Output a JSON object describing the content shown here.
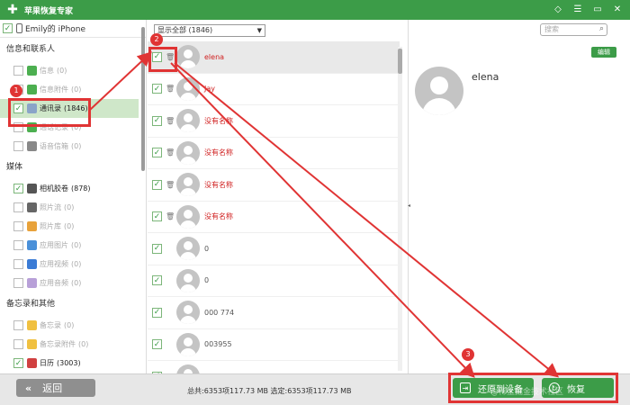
{
  "app": {
    "title": "苹果恢复专家"
  },
  "window_controls": [
    "diamond-icon",
    "settings-icon",
    "minimize-icon",
    "close-icon"
  ],
  "sidebar": {
    "device": "Emily的 iPhone",
    "groups": [
      {
        "title": "信息和联系人",
        "items": [
          {
            "label": "信息",
            "count": "(0)",
            "checked": false,
            "icon": "message-icon",
            "color": "#4caf50"
          },
          {
            "label": "信息附件",
            "count": "(0)",
            "checked": false,
            "icon": "attachment-icon",
            "color": "#4caf50"
          },
          {
            "label": "通讯录",
            "count": "(1846)",
            "checked": true,
            "icon": "contacts-icon",
            "color": "#8aa4c8"
          },
          {
            "label": "通话记录",
            "count": "(0)",
            "checked": false,
            "icon": "phone-icon",
            "color": "#4caf50"
          },
          {
            "label": "语音信箱",
            "count": "(0)",
            "checked": false,
            "icon": "voicemail-icon",
            "color": "#888"
          }
        ]
      },
      {
        "title": "媒体",
        "items": [
          {
            "label": "相机胶卷",
            "count": "(878)",
            "checked": true,
            "icon": "camera-icon",
            "color": "#555"
          },
          {
            "label": "照片流",
            "count": "(0)",
            "checked": false,
            "icon": "photostream-icon",
            "color": "#666"
          },
          {
            "label": "照片库",
            "count": "(0)",
            "checked": false,
            "icon": "photos-icon",
            "color": "#e8a23a"
          },
          {
            "label": "应用图片",
            "count": "(0)",
            "checked": false,
            "icon": "app-photo-icon",
            "color": "#4a90d9"
          },
          {
            "label": "应用视频",
            "count": "(0)",
            "checked": false,
            "icon": "app-video-icon",
            "color": "#3a7bd5"
          },
          {
            "label": "应用音频",
            "count": "(0)",
            "checked": false,
            "icon": "music-icon",
            "color": "#b8a0d8"
          }
        ]
      },
      {
        "title": "备忘录和其他",
        "items": [
          {
            "label": "备忘录",
            "count": "(0)",
            "checked": false,
            "icon": "notes-icon",
            "color": "#f0c040"
          },
          {
            "label": "备忘录附件",
            "count": "(0)",
            "checked": false,
            "icon": "notes-attach-icon",
            "color": "#f0c040"
          },
          {
            "label": "日历",
            "count": "(3003)",
            "checked": true,
            "icon": "calendar-icon",
            "color": "#d04040"
          }
        ]
      }
    ]
  },
  "list": {
    "filter": "显示全部 (1846)",
    "rows": [
      {
        "name": "elena",
        "red": true,
        "checked": true,
        "selected": true
      },
      {
        "name": "Jay",
        "red": true,
        "checked": true,
        "selected": false
      },
      {
        "name": "没有名称",
        "red": true,
        "checked": true,
        "selected": false
      },
      {
        "name": "没有名称",
        "red": true,
        "checked": true,
        "selected": false
      },
      {
        "name": "没有名称",
        "red": true,
        "checked": true,
        "selected": false
      },
      {
        "name": "没有名称",
        "red": true,
        "checked": true,
        "selected": false
      },
      {
        "name": "0",
        "red": false,
        "checked": true,
        "selected": false
      },
      {
        "name": "0",
        "red": false,
        "checked": true,
        "selected": false
      },
      {
        "name": "000 774",
        "red": false,
        "checked": true,
        "selected": false
      },
      {
        "name": "003955",
        "red": false,
        "checked": true,
        "selected": false
      },
      {
        "name": "",
        "red": false,
        "checked": true,
        "selected": false
      }
    ]
  },
  "detail": {
    "search_placeholder": "搜索",
    "edit": "编辑",
    "name": "elena"
  },
  "footer": {
    "back": "返回",
    "totals": "总共:6353项117.73 MB 选定:6353项117.73 MB",
    "restore_device": "还原到设备",
    "recover": "恢复",
    "watermark": "@稀土掘金技术社区"
  },
  "annotations": {
    "step1": "1",
    "step2": "2",
    "step3": "3",
    "color": "#e03434"
  }
}
